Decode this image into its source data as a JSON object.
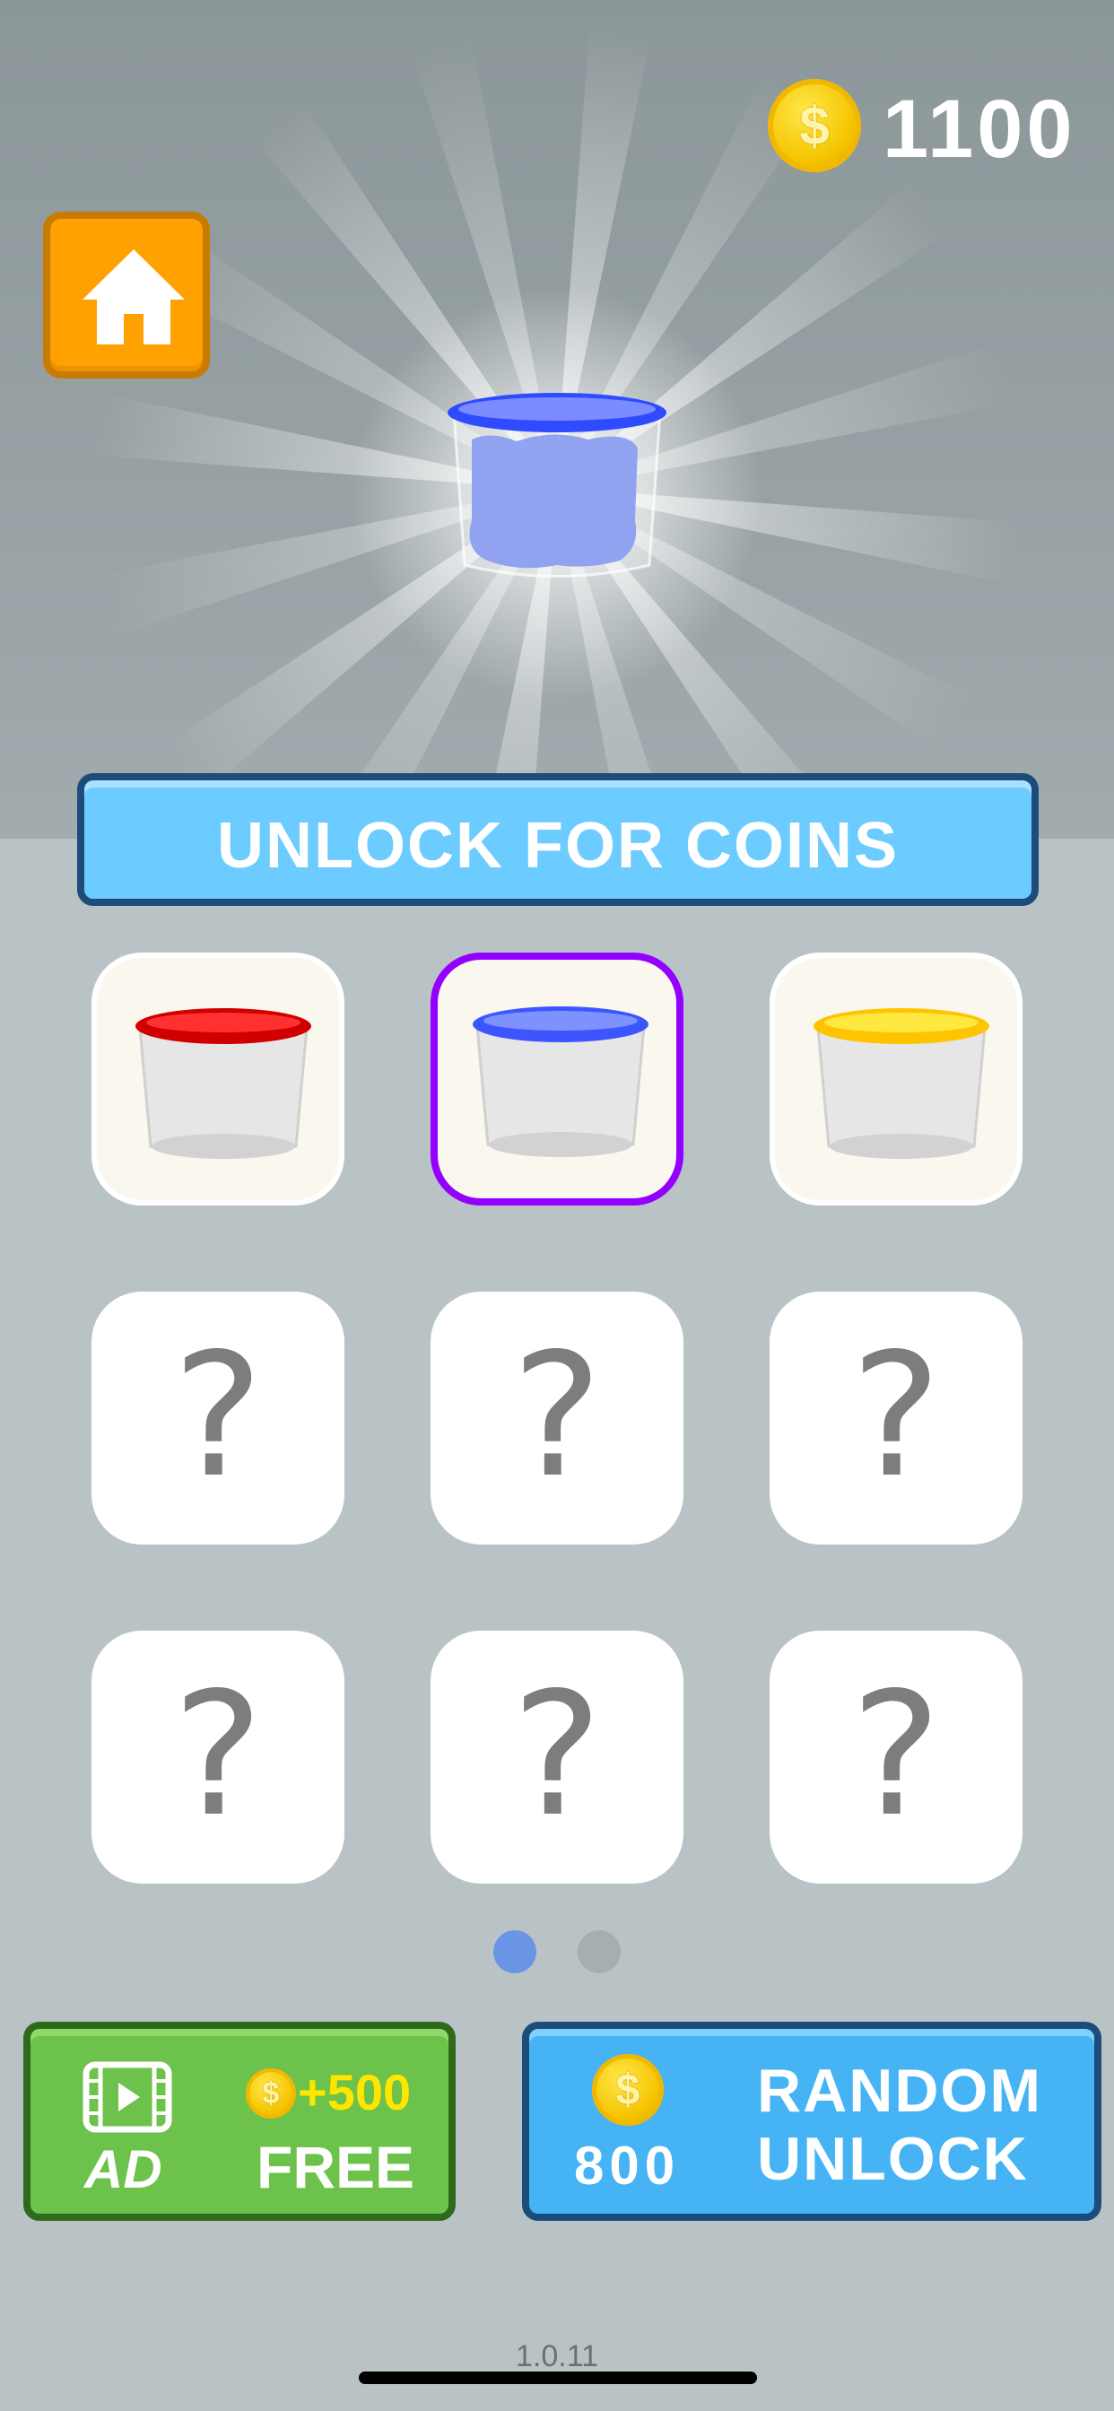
{
  "header": {
    "coin_icon": "coin-icon",
    "coin_symbol": "$",
    "coin_count": "1100",
    "home_icon": "home-icon"
  },
  "banner": {
    "label": "UNLOCK FOR COINS"
  },
  "grid": {
    "tiles": [
      {
        "state": "owned",
        "rim_color": "#e00000"
      },
      {
        "state": "selected",
        "rim_color": "#3d55ff"
      },
      {
        "state": "owned",
        "rim_color": "#ffd600"
      },
      {
        "state": "locked",
        "symbol": "?"
      },
      {
        "state": "locked",
        "symbol": "?"
      },
      {
        "state": "locked",
        "symbol": "?"
      },
      {
        "state": "locked",
        "symbol": "?"
      },
      {
        "state": "locked",
        "symbol": "?"
      },
      {
        "state": "locked",
        "symbol": "?"
      }
    ]
  },
  "pager": {
    "pages": 2,
    "current": 1,
    "active_color": "#6a94e6",
    "inactive_color": "#a7aeb0"
  },
  "ad_button": {
    "video_icon": "video-icon",
    "ad_label": "AD",
    "reward": "+500",
    "free_label": "FREE",
    "coin_symbol": "$"
  },
  "random_button": {
    "coin_symbol": "$",
    "price": "800",
    "line1": "RANDOM",
    "line2": "UNLOCK"
  },
  "footer": {
    "version": "1.0.11"
  }
}
